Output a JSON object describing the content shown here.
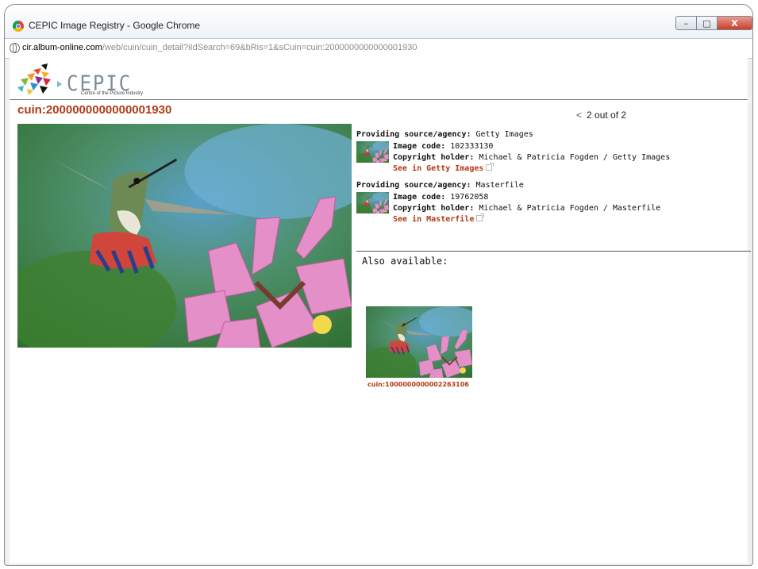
{
  "window": {
    "title": "CEPIC Image Registry - Google Chrome",
    "controls": {
      "minimize": "–",
      "maximize": "□",
      "close": "X"
    }
  },
  "address": {
    "host": "cir.album-online.com",
    "path": "/web/cuin/cuin_detail?iIdSearch=69&bRis=1&sCuin=cuin:2000000000000001930"
  },
  "logo": {
    "name": "CEPIC",
    "subtitle": "Centre of the Picture Industry"
  },
  "page": {
    "cuin_title": "cuin:2000000000000001930",
    "pager": {
      "prev": "<",
      "text": "2 out of 2"
    }
  },
  "sources": [
    {
      "agency_label": "Providing source/agency:",
      "agency": "Getty Images",
      "code_label": "Image code:",
      "code": "102333130",
      "holder_label": "Copyright holder:",
      "holder": "Michael & Patricia Fogden / Getty Images",
      "link": "See in Getty Images"
    },
    {
      "agency_label": "Providing source/agency:",
      "agency": "Masterfile",
      "code_label": "Image code:",
      "code": "19762058",
      "holder_label": "Copyright holder:",
      "holder": "Michael & Patricia Fogden / Masterfile",
      "link": "See in Masterfile"
    }
  ],
  "also": {
    "label": "Also available:",
    "item": "cuin:1000000000002263106"
  }
}
